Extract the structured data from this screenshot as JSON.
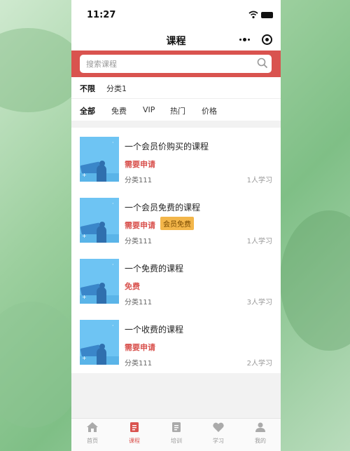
{
  "status": {
    "time": "11:27"
  },
  "nav": {
    "title": "课程"
  },
  "search": {
    "placeholder": "搜索课程"
  },
  "categories": [
    {
      "label": "不限",
      "active": true
    },
    {
      "label": "分类1",
      "active": false
    }
  ],
  "filters": [
    {
      "label": "全部",
      "active": true
    },
    {
      "label": "免费",
      "active": false
    },
    {
      "label": "VIP",
      "active": false
    },
    {
      "label": "热门",
      "active": false
    },
    {
      "label": "价格",
      "active": false
    }
  ],
  "courses": [
    {
      "title": "一个会员价购买的课程",
      "status": "需要申请",
      "badge": "",
      "category": "分类111",
      "learners": "1人学习"
    },
    {
      "title": "一个会员免费的课程",
      "status": "需要申请",
      "badge": "会员免费",
      "category": "分类111",
      "learners": "1人学习"
    },
    {
      "title": "一个免费的课程",
      "status": "免费",
      "badge": "",
      "category": "分类111",
      "learners": "3人学习"
    },
    {
      "title": "一个收费的课程",
      "status": "需要申请",
      "badge": "",
      "category": "分类111",
      "learners": "2人学习"
    }
  ],
  "tabs": [
    {
      "label": "首页",
      "icon": "home-icon",
      "active": false
    },
    {
      "label": "课程",
      "icon": "course-icon",
      "active": true
    },
    {
      "label": "培训",
      "icon": "training-icon",
      "active": false
    },
    {
      "label": "学习",
      "icon": "heart-icon",
      "active": false
    },
    {
      "label": "我的",
      "icon": "profile-icon",
      "active": false
    }
  ],
  "colors": {
    "accent": "#d9534f",
    "badge": "#f3b64a",
    "inactive": "#999999"
  }
}
